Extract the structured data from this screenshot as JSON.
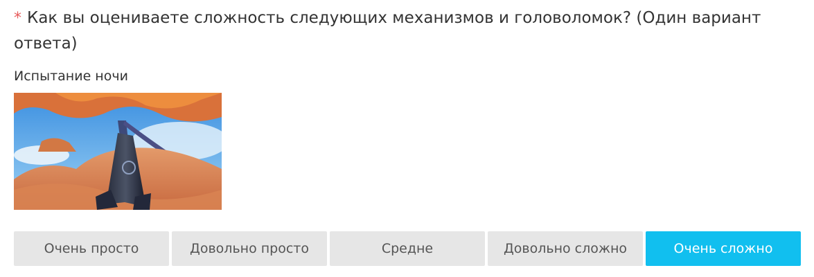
{
  "question": {
    "required_marker": "*",
    "text": "Как вы оцениваете сложность следующих механизмов и головоломок? (Один вариант ответа)"
  },
  "item": {
    "label": "Испытание ночи",
    "image_name": "night-trial-mechanism-screenshot"
  },
  "options": [
    {
      "label": "Очень просто",
      "selected": false
    },
    {
      "label": "Довольно просто",
      "selected": false
    },
    {
      "label": "Средне",
      "selected": false
    },
    {
      "label": "Довольно сложно",
      "selected": false
    },
    {
      "label": "Очень сложно",
      "selected": true
    }
  ],
  "colors": {
    "selected_bg": "#11bfef",
    "option_bg": "#e6e6e6",
    "required": "#e65a5a"
  }
}
